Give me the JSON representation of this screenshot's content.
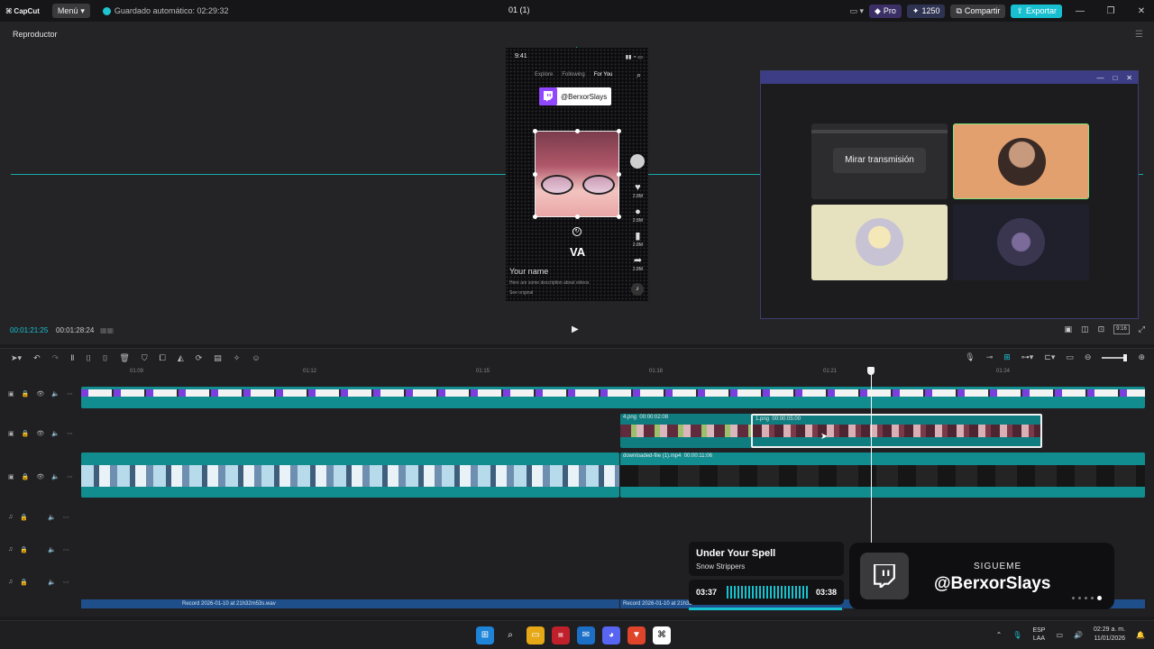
{
  "topbar": {
    "logo": "CapCut",
    "menu_label": "Menú",
    "autosave": "Guardado automático: 02:29:32",
    "project_title": "01 (1)",
    "pro_label": "Pro",
    "credits": "1250",
    "share_label": "Compartir",
    "export_label": "Exportar"
  },
  "player": {
    "title": "Reproductor",
    "current_time": "00:01:21:25",
    "total_time": "00:01:28:24",
    "ratio_label": "9:16"
  },
  "phone": {
    "time": "9:41",
    "tabs": [
      "Explore",
      "Following",
      "For You"
    ],
    "twitch_handle": "@BerxorSlays",
    "caption": "VA",
    "counts": [
      "2.8M",
      "2.8M",
      "2.8M",
      "2.8M"
    ],
    "name": "Your name",
    "description": "Here are some description about videos",
    "original": "See original"
  },
  "floating_window": {
    "watch_button": "Mirar transmisión"
  },
  "timeline": {
    "ruler_ticks": [
      "01:09",
      "01:12",
      "01:15",
      "01:18",
      "01:21",
      "01:24"
    ],
    "clip_4png": {
      "name": "4.png",
      "duration": "00:00:02:08"
    },
    "clip_1png": {
      "name": "1.png",
      "duration": "00:00:05:00"
    },
    "clip_download": {
      "name": "downloaded-file (1).mp4",
      "duration": "00:00:11:06"
    },
    "audio_1": "Record 2026-01-10 at 21h32m53s.wav",
    "audio_2": "Record 2026-01-10 at 21h32m53s.wav"
  },
  "now_playing": {
    "title": "Under Your Spell",
    "artist": "Snow Strippers",
    "start": "03:37",
    "end": "03:38",
    "progress": 0.99
  },
  "follow": {
    "label": "SIGUEME",
    "handle": "@BerxorSlays"
  },
  "taskbar": {
    "lang_1": "ESP",
    "lang_2": "LAA",
    "time": "02:29 a. m.",
    "date": "11/01/2026"
  },
  "colors": {
    "accent": "#17c2d0",
    "twitch": "#9146ff",
    "clip_teal": "#118c8f",
    "audio_blue": "#1e4f8a"
  }
}
